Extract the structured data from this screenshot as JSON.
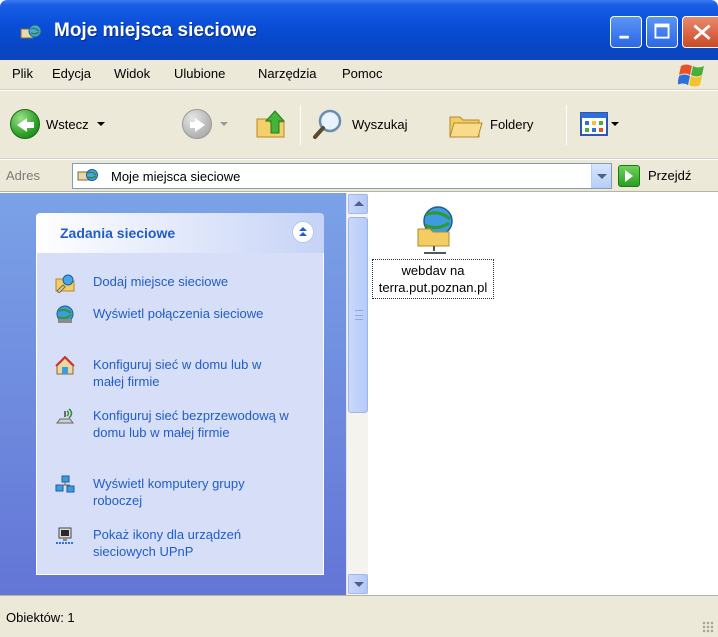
{
  "window": {
    "title": "Moje miejsca sieciowe",
    "app_icon": "network-places-icon"
  },
  "menu": {
    "items": [
      {
        "label": "Plik"
      },
      {
        "label": "Edycja"
      },
      {
        "label": "Widok"
      },
      {
        "label": "Ulubione"
      },
      {
        "label": "Narzędzia"
      },
      {
        "label": "Pomoc"
      }
    ]
  },
  "toolbar": {
    "back_label": "Wstecz",
    "search_label": "Wyszukaj",
    "folders_label": "Foldery"
  },
  "address": {
    "label": "Adres",
    "value": "Moje miejsca sieciowe",
    "go_label": "Przejdź"
  },
  "taskpane": {
    "title": "Zadania sieciowe",
    "tasks": [
      {
        "label": "Dodaj miejsce sieciowe",
        "icon": "add-network-place-icon"
      },
      {
        "label": "Wyświetl połączenia sieciowe",
        "icon": "network-connections-icon"
      },
      {
        "label": "Konfiguruj sieć w domu lub w małej firmie",
        "icon": "home-network-icon"
      },
      {
        "label": "Konfiguruj sieć bezprzewodową w domu lub w małej firmie",
        "icon": "wireless-network-icon"
      },
      {
        "label": "Wyświetl komputery grupy roboczej",
        "icon": "workgroup-computers-icon"
      },
      {
        "label": "Pokaż ikony dla urządzeń sieciowych UPnP",
        "icon": "upnp-device-icon"
      }
    ]
  },
  "content": {
    "items": [
      {
        "label": "webdav na terra.put.poznan.pl",
        "icon": "network-folder-icon"
      }
    ]
  },
  "status": {
    "text": "Obiektów: 1"
  },
  "colors": {
    "titlebar": "#0a4fd8",
    "taskpane_bg": "#6f8de0",
    "task_link": "#215dc6",
    "chrome": "#ece9d8"
  }
}
